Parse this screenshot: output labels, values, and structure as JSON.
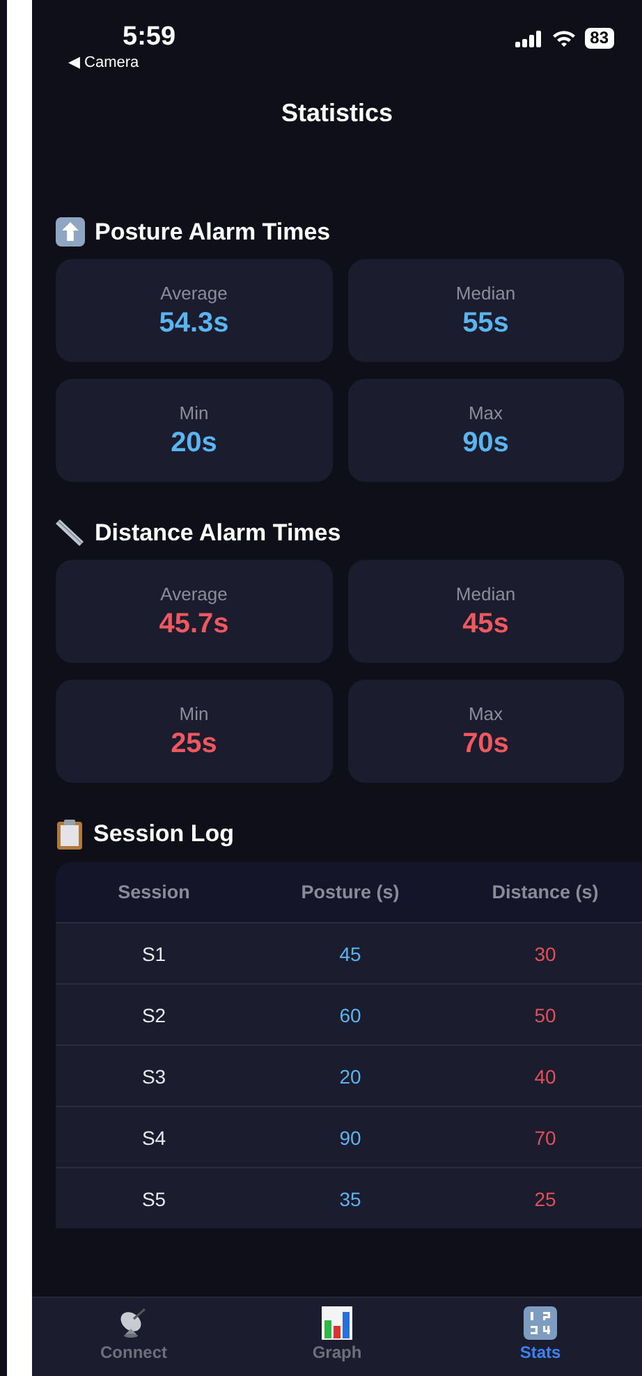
{
  "status_bar": {
    "time": "5:59",
    "back_link": "◀ Camera",
    "battery": "83"
  },
  "title": "Statistics",
  "sections": [
    {
      "kind": "posture",
      "title": "Posture Alarm Times",
      "color": "#5ab4f0",
      "stats": [
        {
          "label": "Average",
          "value": "54.3s"
        },
        {
          "label": "Median",
          "value": "55s"
        },
        {
          "label": "Min",
          "value": "20s"
        },
        {
          "label": "Max",
          "value": "90s"
        }
      ]
    },
    {
      "kind": "distance",
      "title": "Distance Alarm Times",
      "color": "#f0585f",
      "stats": [
        {
          "label": "Average",
          "value": "45.7s"
        },
        {
          "label": "Median",
          "value": "45s"
        },
        {
          "label": "Min",
          "value": "25s"
        },
        {
          "label": "Max",
          "value": "70s"
        }
      ]
    }
  ],
  "session_log": {
    "title": "Session Log",
    "table": {
      "columns": [
        "Session",
        "Posture (s)",
        "Distance (s)"
      ],
      "rows": [
        [
          "S1",
          "45",
          "30"
        ],
        [
          "S2",
          "60",
          "50"
        ],
        [
          "S3",
          "20",
          "40"
        ],
        [
          "S4",
          "90",
          "70"
        ],
        [
          "S5",
          "35",
          "25"
        ]
      ]
    }
  },
  "tabs": [
    {
      "kind": "connect",
      "label": "Connect",
      "selected": false
    },
    {
      "kind": "graph",
      "label": "Graph",
      "selected": false
    },
    {
      "kind": "stats",
      "label": "Stats",
      "selected": true
    }
  ]
}
